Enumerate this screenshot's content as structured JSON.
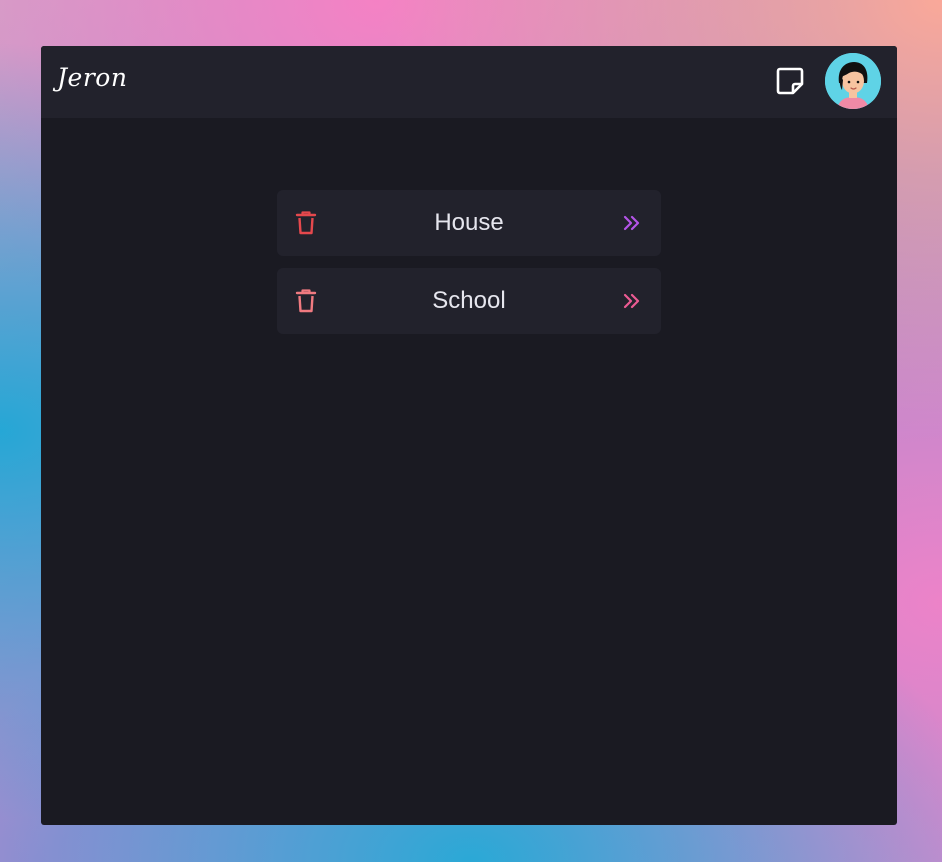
{
  "header": {
    "brand": "Jeron",
    "note_icon": "sticky-note-icon",
    "avatar_icon": "user-avatar"
  },
  "lists": [
    {
      "label": "House",
      "delete_icon": "trash-icon",
      "open_icon": "double-chevron-right-icon",
      "trash_color": "#e5484d",
      "arrow_color": "#b454e8"
    },
    {
      "label": "School",
      "delete_icon": "trash-icon",
      "open_icon": "double-chevron-right-icon",
      "trash_color": "#f07a80",
      "arrow_color": "#ec5b93"
    }
  ],
  "colors": {
    "window_bg": "#1a1a22",
    "topbar_bg": "#22222c",
    "card_bg": "#22222c",
    "text": "#e6e6ee",
    "avatar_bg": "#5fd3e6"
  }
}
